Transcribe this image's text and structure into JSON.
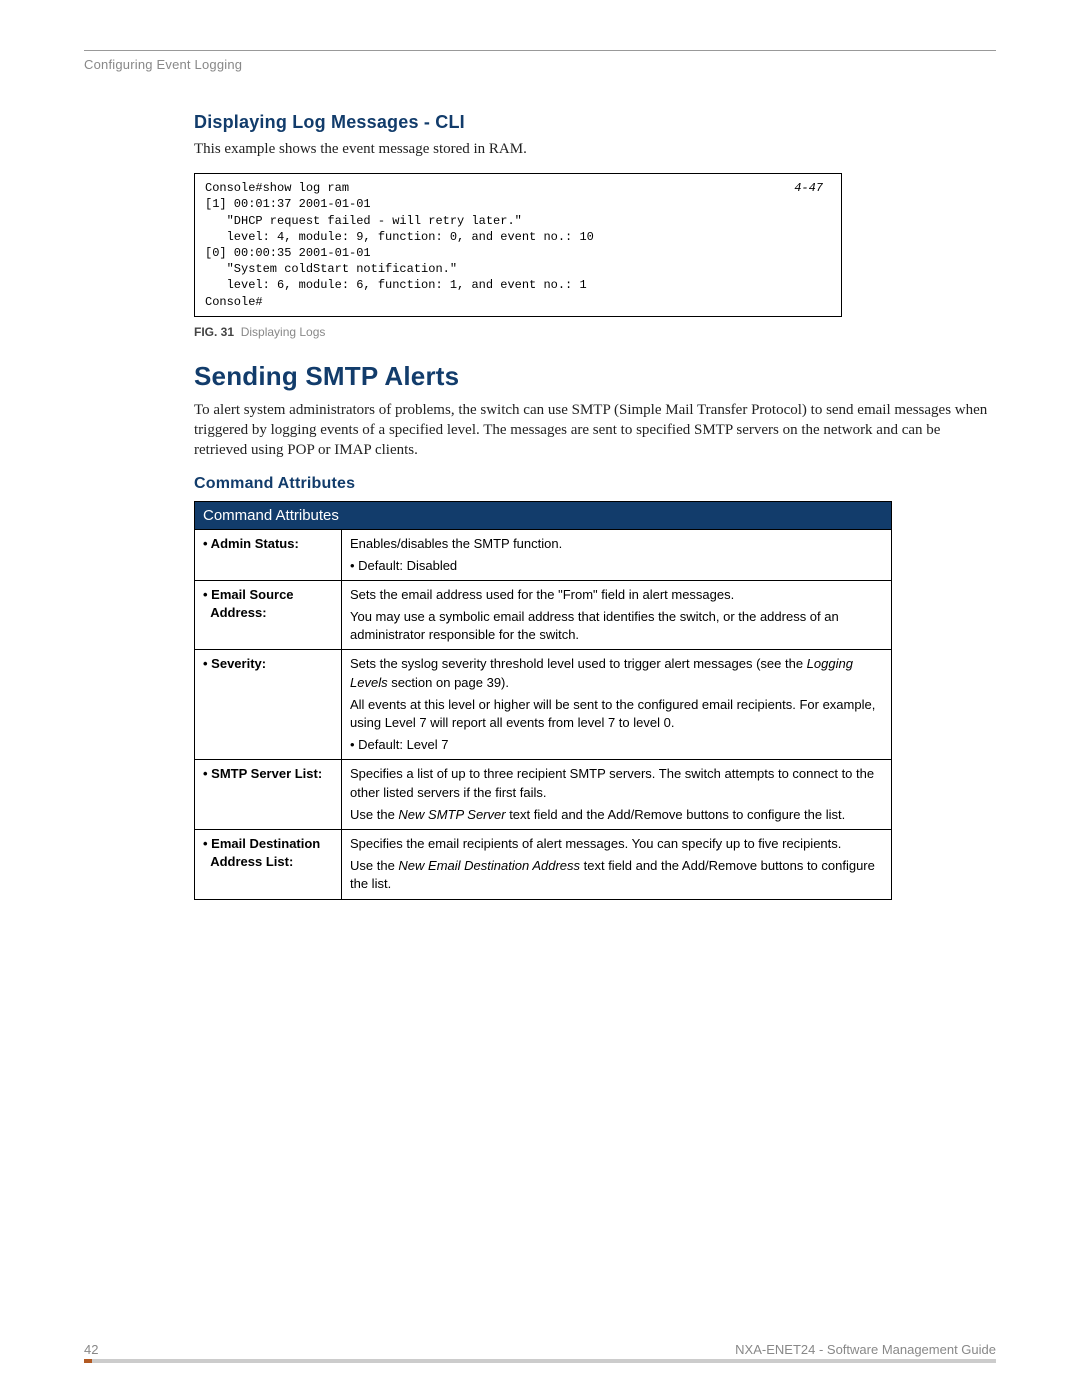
{
  "running_header": "Configuring Event Logging",
  "section1": {
    "heading": "Displaying Log Messages - CLI",
    "intro": "This example shows the event message stored in RAM.",
    "code_ref": "4-47",
    "code": "Console#show log ram\n[1] 00:01:37 2001-01-01\n   \"DHCP request failed - will retry later.\"\n   level: 4, module: 9, function: 0, and event no.: 10\n[0] 00:00:35 2001-01-01\n   \"System coldStart notification.\"\n   level: 6, module: 6, function: 1, and event no.: 1\nConsole#",
    "fig_label": "FIG. 31",
    "fig_title": "Displaying Logs"
  },
  "section2": {
    "heading": "Sending SMTP Alerts",
    "intro": "To alert system administrators of problems, the switch can use SMTP (Simple Mail Transfer Protocol) to send email messages when triggered by logging events of a specified level. The messages are sent to specified SMTP servers on the network and can be retrieved using POP or IMAP clients.",
    "sub_heading": "Command Attributes",
    "table_header": "Command Attributes",
    "rows": {
      "r1_label": "• Admin Status:",
      "r1_p1": "Enables/disables the SMTP function.",
      "r1_p2": "• Default: Disabled",
      "r2_label": "• Email Source Address:",
      "r2_p1": "Sets the email address used for the \"From\" field in alert messages.",
      "r2_p2": "You may use a symbolic email address that identifies the switch, or the address of an administrator responsible for the switch.",
      "r3_label": "• Severity:",
      "r3_p1a": "Sets the syslog severity threshold level used to trigger alert messages (see the ",
      "r3_p1i": "Logging Levels",
      "r3_p1b": " section on page 39).",
      "r3_p2": "All events at this level or higher will be sent to the configured email recipients. For example, using Level 7 will report all events from level 7 to level 0.",
      "r3_p3": "• Default: Level 7",
      "r4_label": "• SMTP Server List:",
      "r4_p1": "Specifies a list of up to three recipient SMTP servers. The switch attempts to connect to the other listed servers if the first fails.",
      "r4_p2a": "Use the ",
      "r4_p2i": "New SMTP Server",
      "r4_p2b": " text field and the Add/Remove buttons to configure the list.",
      "r5_label": "• Email Destination Address List:",
      "r5_p1": "Specifies the email recipients of alert messages. You can specify up to five recipients.",
      "r5_p2a": "Use the ",
      "r5_p2i": "New Email Destination Address",
      "r5_p2b": " text field and the Add/Remove buttons to configure the list."
    }
  },
  "footer": {
    "page_number": "42",
    "doc_title": "NXA-ENET24 - Software Management Guide"
  }
}
